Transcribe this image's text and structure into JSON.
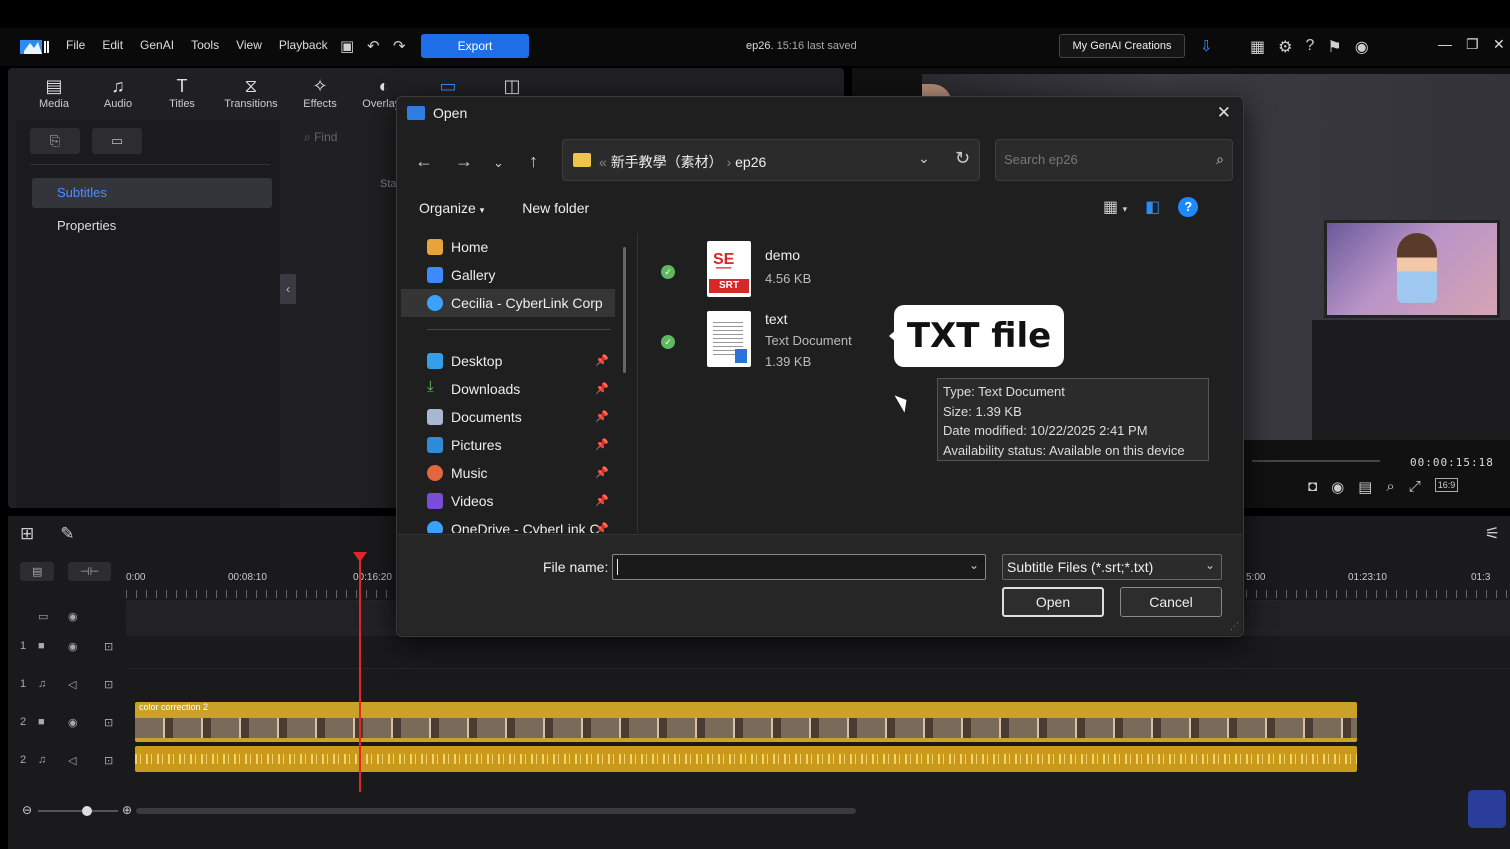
{
  "app": {
    "menu": [
      "File",
      "Edit",
      "GenAI",
      "Tools",
      "View",
      "Playback"
    ],
    "export_label": "Export",
    "project_name": "ep26.",
    "project_saved": "15:16 last saved",
    "genai_button": "My GenAI Creations"
  },
  "library": {
    "tabs": [
      {
        "label": "Media",
        "icon": "media-icon"
      },
      {
        "label": "Audio",
        "icon": "music-note-icon"
      },
      {
        "label": "Titles",
        "icon": "title-t-icon"
      },
      {
        "label": "Transitions",
        "icon": "transition-icon"
      },
      {
        "label": "Effects",
        "icon": "effects-icon"
      },
      {
        "label": "Overlays",
        "icon": "overlays-icon"
      }
    ],
    "sidebar_items": [
      "Subtitles",
      "Properties"
    ],
    "find_placeholder": "Find",
    "column_partial": "Sta"
  },
  "preview": {
    "timecode": "00:00:15:18",
    "aspect": "16:9"
  },
  "timeline": {
    "ruler_labels": [
      "0:00",
      "00:08:10",
      "00:16:20",
      "5:00",
      "01:23:10",
      "01:3"
    ],
    "tracks": [
      {
        "num": "1",
        "kind": "video"
      },
      {
        "num": "1",
        "kind": "audio"
      },
      {
        "num": "2",
        "kind": "video"
      },
      {
        "num": "2",
        "kind": "audio"
      }
    ],
    "clip_name": "color correction 2"
  },
  "dialog": {
    "title": "Open",
    "path_parent": "新手教學（素材）",
    "path_current": "ep26",
    "search_placeholder": "Search ep26",
    "organize_label": "Organize",
    "new_folder_label": "New folder",
    "nav_items": [
      {
        "label": "Home",
        "icon": "home-icon",
        "pinned": false
      },
      {
        "label": "Gallery",
        "icon": "gallery-icon",
        "pinned": false
      },
      {
        "label": "Cecilia - CyberLink Corp",
        "icon": "onedrive-cloud-icon",
        "pinned": false
      },
      {
        "label": "Desktop",
        "icon": "desktop-icon",
        "pinned": true
      },
      {
        "label": "Downloads",
        "icon": "download-arrow-icon",
        "pinned": true
      },
      {
        "label": "Documents",
        "icon": "documents-icon",
        "pinned": true
      },
      {
        "label": "Pictures",
        "icon": "pictures-icon",
        "pinned": true
      },
      {
        "label": "Music",
        "icon": "music-icon",
        "pinned": true
      },
      {
        "label": "Videos",
        "icon": "videos-icon",
        "pinned": true
      },
      {
        "label": "OneDrive - CyberLink C",
        "icon": "onedrive-cloud-icon",
        "pinned": true
      }
    ],
    "files": [
      {
        "name": "demo",
        "type": "",
        "size": "4.56 KB",
        "icon": "srt-file-icon"
      },
      {
        "name": "text",
        "type": "Text Document",
        "size": "1.39 KB",
        "icon": "text-file-icon"
      }
    ],
    "callout": "TXT file",
    "tooltip": {
      "type": "Type: Text Document",
      "size": "Size: 1.39 KB",
      "modified": "Date modified: 10/22/2025 2:41 PM",
      "availability": "Availability status: Available on this device"
    },
    "file_name_label": "File name:",
    "file_name_value": "",
    "file_type": "Subtitle Files (*.srt;*.txt)",
    "open_label": "Open",
    "cancel_label": "Cancel"
  },
  "colors": {
    "accent": "#1e6ee8",
    "clip": "#c9a227",
    "playhead": "#e02828"
  }
}
